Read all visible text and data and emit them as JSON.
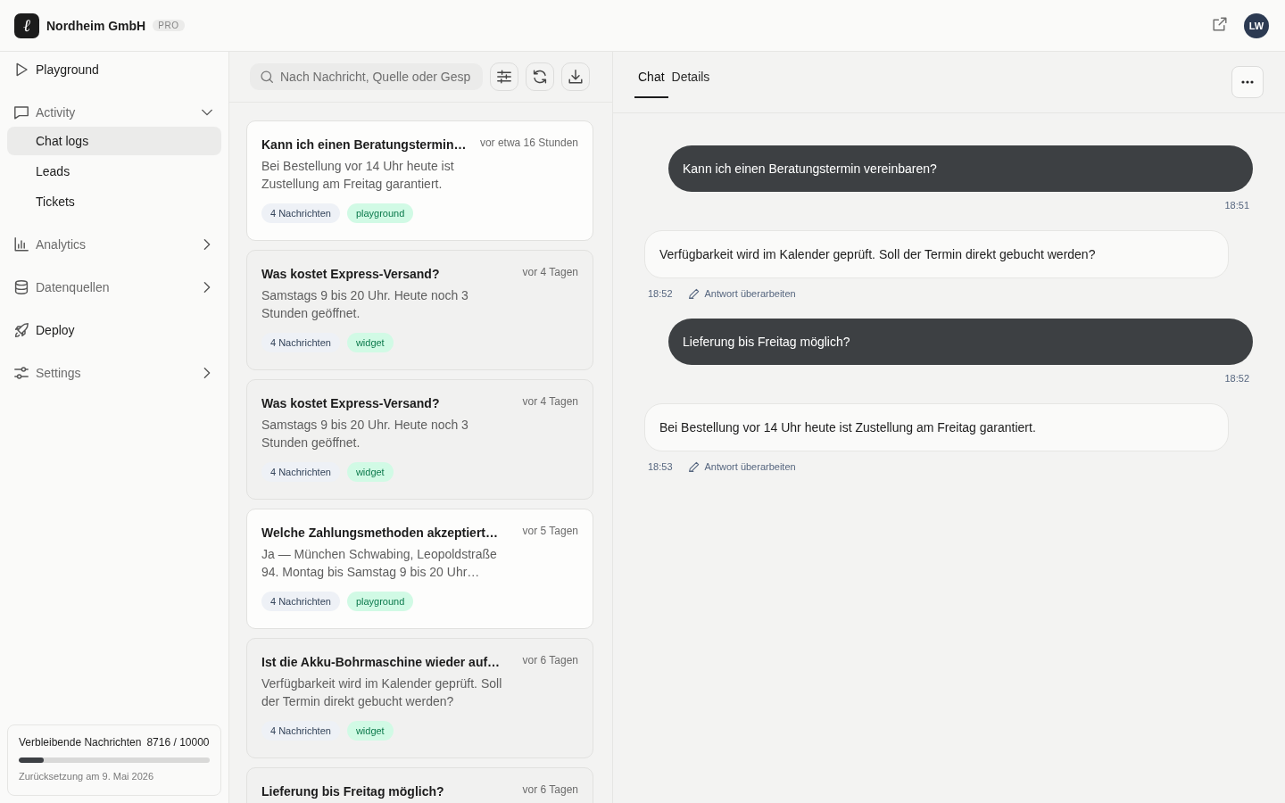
{
  "header": {
    "logo": "ℓ",
    "brand": "Nordheim GmbH",
    "plan": "PRO",
    "avatar": "LW"
  },
  "sidebar": {
    "items": [
      {
        "kind": "link",
        "label": "Playground",
        "selected": false
      },
      {
        "kind": "group",
        "label": "Activity",
        "selected": false,
        "expanded": true,
        "children": [
          {
            "label": "Chat logs",
            "selected": true
          },
          {
            "label": "Leads",
            "selected": false
          },
          {
            "label": "Tickets",
            "selected": false
          }
        ]
      },
      {
        "kind": "group",
        "label": "Analytics",
        "selected": false,
        "expanded": false
      },
      {
        "kind": "group",
        "label": "Datenquellen",
        "selected": false,
        "expanded": false
      },
      {
        "kind": "link",
        "label": "Deploy",
        "selected": false
      },
      {
        "kind": "group",
        "label": "Settings",
        "selected": false,
        "expanded": false
      }
    ],
    "usage": {
      "label": "Verbleibende Nachrichten",
      "count": "8716 / 10000",
      "level": 0.13,
      "reset": "Zurücksetzung am 9. Mai 2026"
    }
  },
  "conversations": {
    "search": {
      "placeholder": "Nach Nachricht, Quelle oder Gesp"
    },
    "items": [
      {
        "title": "Kann ich einen Beratungstermin…",
        "time": "vor etwa 16 Stunden",
        "preview": "Bei Bestellung vor 14 Uhr heute ist Zustellung am Freitag garantiert.",
        "message_count": "4 Nachrichten",
        "source": "playground",
        "highlighted": true
      },
      {
        "title": "Was kostet Express-Versand?",
        "time": "vor 4 Tagen",
        "preview": "Samstags 9 bis 20 Uhr. Heute noch 3 Stunden geöffnet.",
        "message_count": "4 Nachrichten",
        "source": "widget",
        "highlighted": false
      },
      {
        "title": "Was kostet Express-Versand?",
        "time": "vor 4 Tagen",
        "preview": "Samstags 9 bis 20 Uhr. Heute noch 3 Stunden geöffnet.",
        "message_count": "4 Nachrichten",
        "source": "widget",
        "highlighted": false
      },
      {
        "title": "Welche Zahlungsmethoden akzeptiert…",
        "time": "vor 5 Tagen",
        "preview": "Ja — München Schwabing, Leopoldstraße 94. Montag bis Samstag 9 bis 20 Uhr…",
        "message_count": "4 Nachrichten",
        "source": "playground",
        "highlighted": true
      },
      {
        "title": "Ist die Akku-Bohrmaschine wieder auf…",
        "time": "vor 6 Tagen",
        "preview": "Verfügbarkeit wird im Kalender geprüft. Soll der Termin direkt gebucht werden?",
        "message_count": "4 Nachrichten",
        "source": "widget",
        "highlighted": false
      },
      {
        "title": "Lieferung bis Freitag möglich?",
        "time": "vor 6 Tagen",
        "highlighted": false
      }
    ]
  },
  "chat": {
    "tabs": [
      {
        "label": "Chat",
        "selected": true
      },
      {
        "label": "Details",
        "selected": false
      }
    ],
    "messages": [
      {
        "kind": "user",
        "text": "Kann ich einen Beratungstermin vereinbaren?",
        "time": "18:51"
      },
      {
        "kind": "assistant",
        "text": "Verfügbarkeit wird im Kalender geprüft. Soll der Termin direkt gebucht werden?",
        "time": "18:52",
        "action": "Antwort überarbeiten"
      },
      {
        "kind": "user",
        "text": "Lieferung bis Freitag möglich?",
        "time": "18:52"
      },
      {
        "kind": "assistant",
        "text": "Bei Bestellung vor 14 Uhr heute ist Zustellung am Freitag garantiert.",
        "time": "18:53",
        "action": "Antwort überarbeiten"
      }
    ]
  }
}
